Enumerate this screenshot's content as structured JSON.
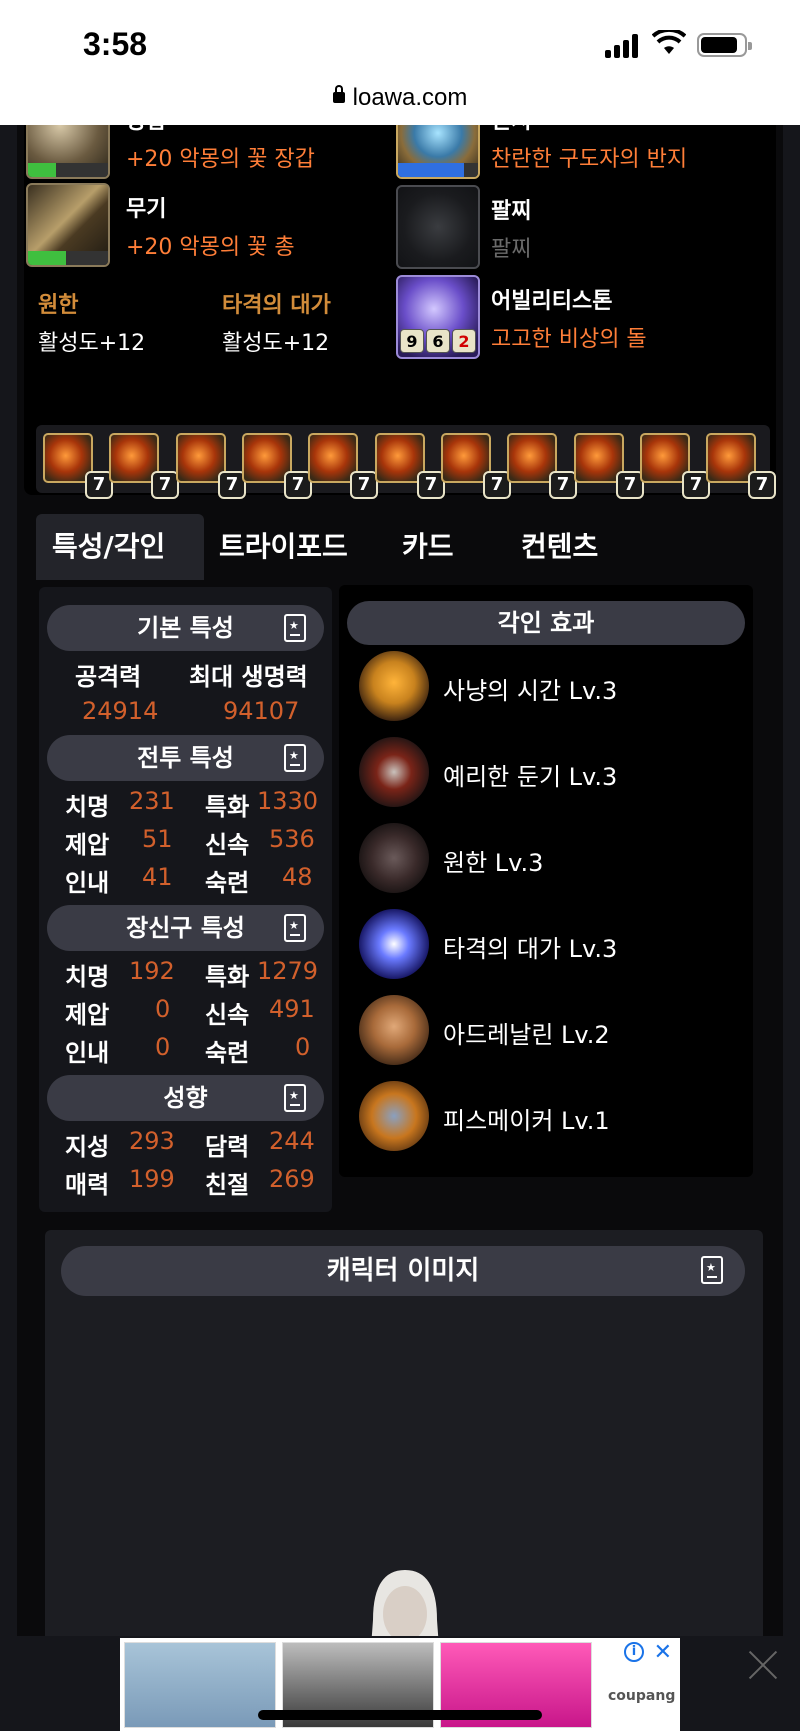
{
  "status": {
    "time": "3:58"
  },
  "browser": {
    "url": "loawa.com"
  },
  "equipment": {
    "left": [
      {
        "slot": "장갑",
        "name": "+20 악몽의 꽃 장갑",
        "quality": 30
      },
      {
        "slot": "무기",
        "name": "+20 악몽의 꽃 총",
        "quality": 55
      }
    ],
    "right": [
      {
        "slot": "반지",
        "name": "찬란한 구도자의 반지",
        "quality": 85
      },
      {
        "slot": "팔찌",
        "name": "팔찌"
      },
      {
        "slot": "어빌리티스톤",
        "name": "고고한 비상의 돌",
        "nums": [
          "9",
          "6",
          "2"
        ]
      }
    ],
    "bonus": [
      {
        "title": "원한",
        "value": "활성도+12"
      },
      {
        "title": "타격의 대가",
        "value": "활성도+12"
      }
    ]
  },
  "gems": [
    "7",
    "7",
    "7",
    "7",
    "7",
    "7",
    "7",
    "7",
    "7",
    "7",
    "7"
  ],
  "tabs": [
    "특성/각인",
    "트라이포드",
    "카드",
    "컨텐츠"
  ],
  "stats": {
    "basic": {
      "title": "기본 특성",
      "attack_label": "공격력",
      "attack": "24914",
      "hp_label": "최대 생명력",
      "hp": "94107"
    },
    "combat": {
      "title": "전투 특성",
      "rows": [
        {
          "l1": "치명",
          "v1": "231",
          "l2": "특화",
          "v2": "1330"
        },
        {
          "l1": "제압",
          "v1": "51",
          "l2": "신속",
          "v2": "536"
        },
        {
          "l1": "인내",
          "v1": "41",
          "l2": "숙련",
          "v2": "48"
        }
      ]
    },
    "accessory": {
      "title": "장신구 특성",
      "rows": [
        {
          "l1": "치명",
          "v1": "192",
          "l2": "특화",
          "v2": "1279"
        },
        {
          "l1": "제압",
          "v1": "0",
          "l2": "신속",
          "v2": "491"
        },
        {
          "l1": "인내",
          "v1": "0",
          "l2": "숙련",
          "v2": "0"
        }
      ]
    },
    "tendency": {
      "title": "성향",
      "rows": [
        {
          "l1": "지성",
          "v1": "293",
          "l2": "담력",
          "v2": "244"
        },
        {
          "l1": "매력",
          "v1": "199",
          "l2": "친절",
          "v2": "269"
        }
      ]
    }
  },
  "engravings": {
    "title": "각인 효과",
    "items": [
      {
        "name": "사냥의 시간 Lv.3",
        "color": "#c8821e"
      },
      {
        "name": "예리한 둔기 Lv.3",
        "color": "#7a2418"
      },
      {
        "name": "원한 Lv.3",
        "color": "#3a2a2a"
      },
      {
        "name": "타격의 대가 Lv.3",
        "color": "#3a4ae0"
      },
      {
        "name": "아드레날린 Lv.2",
        "color": "#a86a3a"
      },
      {
        "name": "피스메이커 Lv.1",
        "color": "#c8761e"
      }
    ]
  },
  "character": {
    "title": "캐릭터 이미지"
  },
  "ad": {
    "brand": "coupang"
  }
}
